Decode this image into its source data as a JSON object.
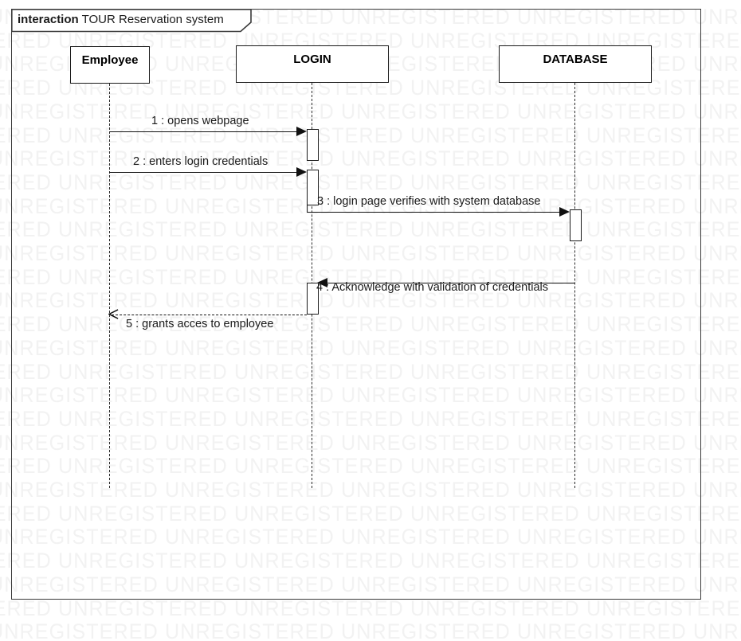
{
  "diagram": {
    "kind_keyword": "interaction",
    "title": "TOUR Reservation system",
    "type": "uml-sequence-diagram"
  },
  "watermark": {
    "text": "UNREGISTERED UNREGISTERED UNREGISTERED UNREGISTERED UNREGISTERED UNREGISTERED",
    "color": "#f2f2f2"
  },
  "lifelines": [
    {
      "id": "employee",
      "label": "Employee"
    },
    {
      "id": "login",
      "label": "LOGIN"
    },
    {
      "id": "database",
      "label": "DATABASE"
    }
  ],
  "messages": [
    {
      "number": "1",
      "label": "1 : opens webpage",
      "from": "employee",
      "to": "login",
      "style": "solid",
      "arrowhead": "filled",
      "direction": "right"
    },
    {
      "number": "2",
      "label": "2 : enters login credentials",
      "from": "employee",
      "to": "login",
      "style": "solid",
      "arrowhead": "filled",
      "direction": "right"
    },
    {
      "number": "3",
      "label": "3 : login page verifies with system database",
      "from": "login",
      "to": "database",
      "style": "solid",
      "arrowhead": "filled",
      "direction": "right"
    },
    {
      "number": "4",
      "label": "4 : Acknowledge with validation of credentials",
      "from": "database",
      "to": "login",
      "style": "solid",
      "arrowhead": "filled",
      "direction": "left"
    },
    {
      "number": "5",
      "label": "5 : grants acces to employee",
      "from": "login",
      "to": "employee",
      "style": "dashed",
      "arrowhead": "open",
      "direction": "left"
    }
  ],
  "colors": {
    "line": "#1a1a1a",
    "frame": "#3a3a3a",
    "background": "#ffffff",
    "watermark": "#f2f2f2"
  }
}
